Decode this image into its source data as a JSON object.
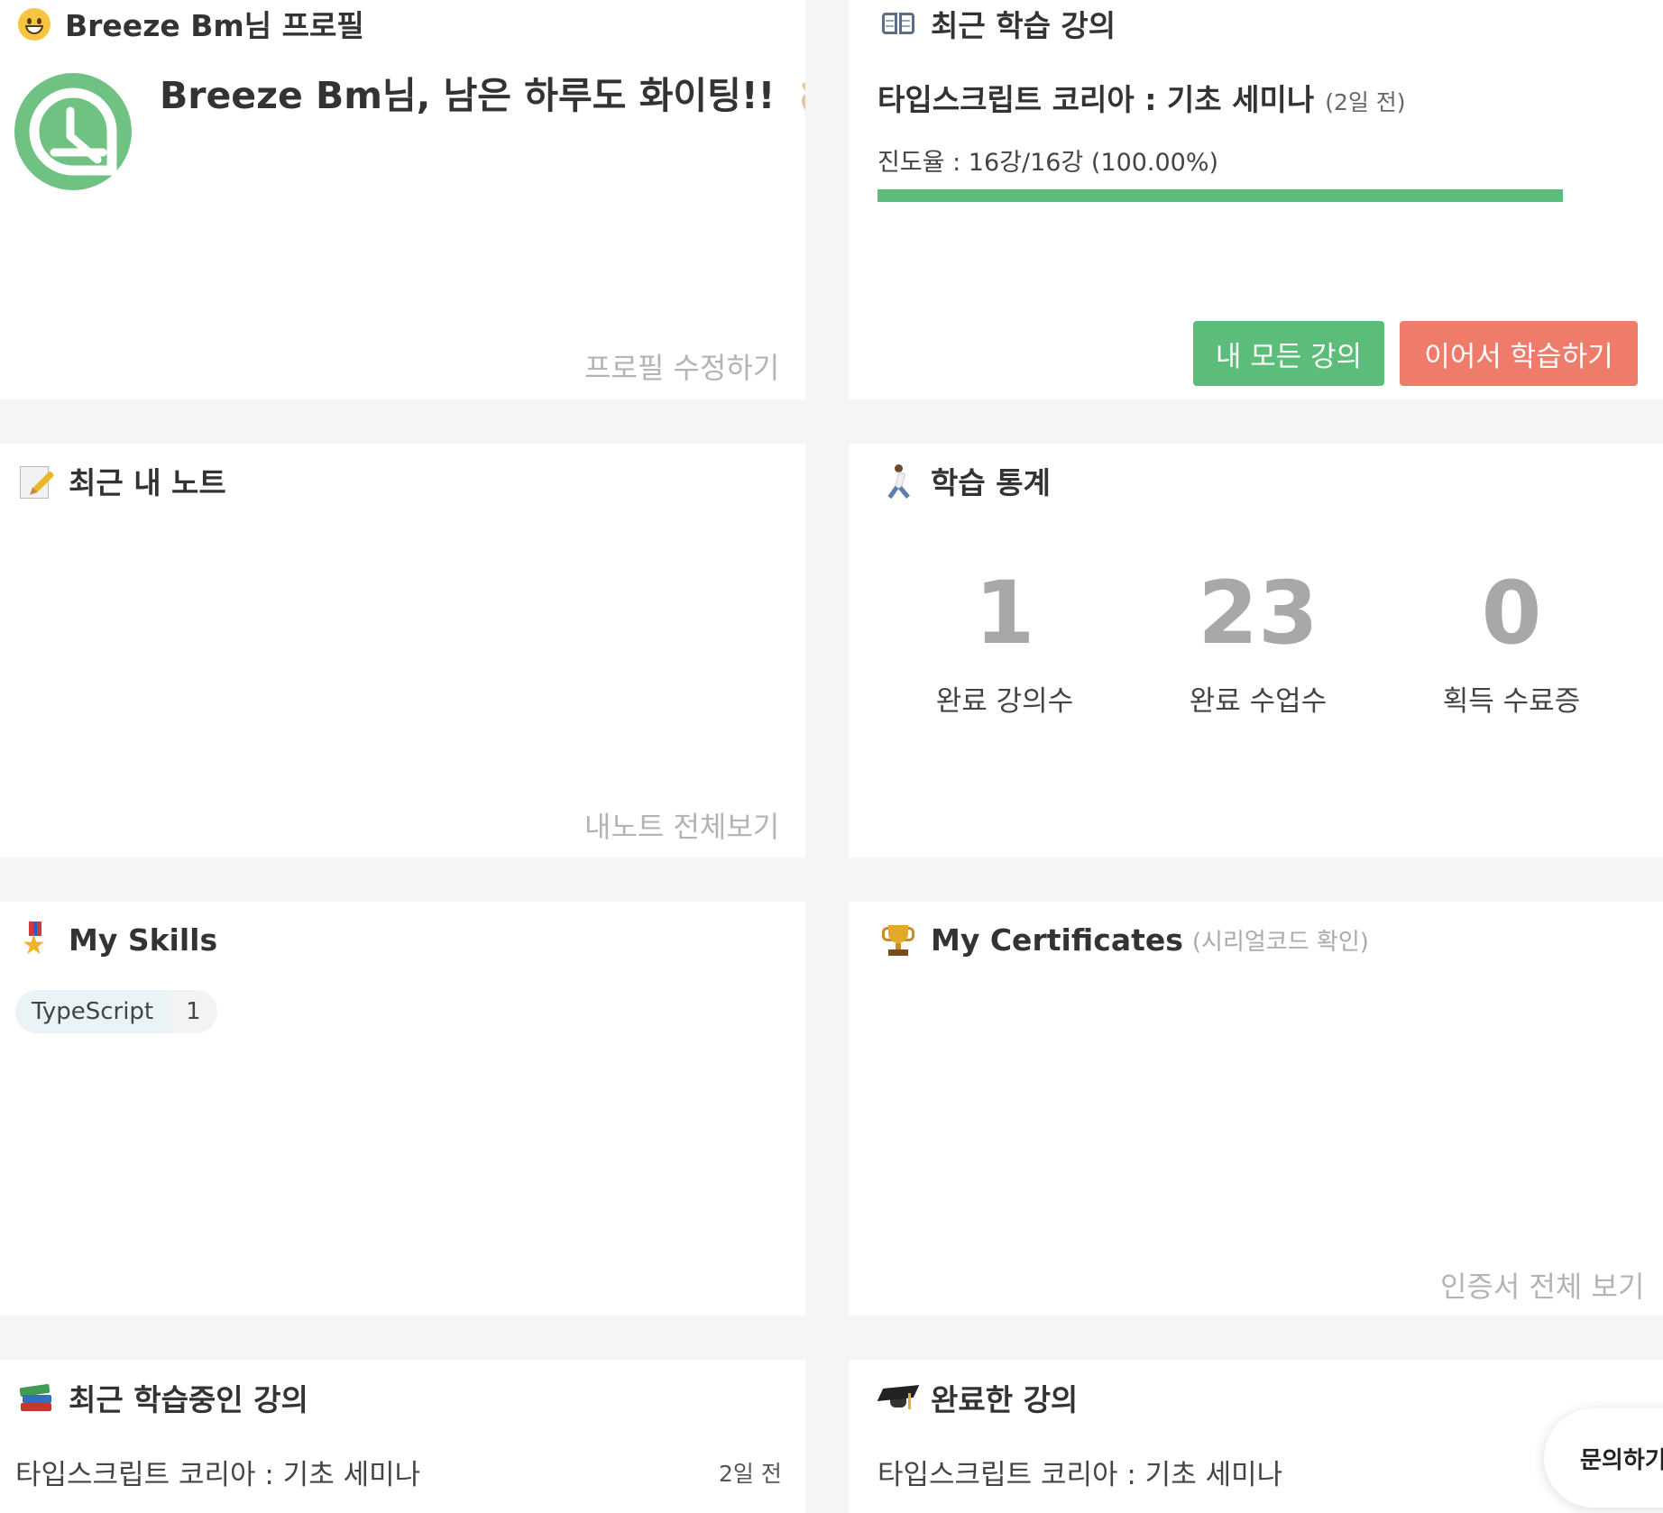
{
  "profile": {
    "title": "Breeze Bm님 프로필",
    "greeting": "Breeze Bm님, 남은 하루도 화이팅!!",
    "edit_link": "프로필 수정하기"
  },
  "recent_course": {
    "title": "최근 학습 강의",
    "course_name": "타입스크립트 코리아 : 기초 세미나",
    "ago": "(2일 전)",
    "progress_text": "진도율 : 16강/16강 (100.00%)",
    "progress_fraction": 1.0,
    "all_courses_button": "내 모든 강의",
    "continue_button": "이어서 학습하기"
  },
  "notes": {
    "title": "최근 내 노트",
    "view_all_link": "내노트 전체보기"
  },
  "stats": {
    "title": "학습 통계",
    "items": [
      {
        "value": "1",
        "label": "완료 강의수"
      },
      {
        "value": "23",
        "label": "완료 수업수"
      },
      {
        "value": "0",
        "label": "획득 수료증"
      }
    ]
  },
  "skills": {
    "title": "My Skills",
    "items": [
      {
        "name": "TypeScript",
        "count": "1"
      }
    ]
  },
  "certificates": {
    "title": "My Certificates",
    "subtitle": "(시리얼코드 확인)",
    "view_all_link": "인증서 전체 보기"
  },
  "learning_courses": {
    "title": "최근 학습중인 강의",
    "items": [
      {
        "name": "타입스크립트 코리아 : 기초 세미나",
        "ago": "2일 전"
      }
    ]
  },
  "completed_courses": {
    "title": "완료한 강의",
    "items": [
      {
        "name": "타입스크립트 코리아 : 기초 세미나"
      }
    ]
  },
  "inquiry_button": "문의하기",
  "colors": {
    "accent_green": "#5cbd7a",
    "accent_red": "#ef7b6b",
    "muted_text": "#b4b4b4"
  },
  "icons": {
    "profile": "smiley-icon",
    "recent_course": "open-book-icon",
    "notes": "memo-icon",
    "stats": "runner-icon",
    "skills": "medal-icon",
    "certificates": "trophy-icon",
    "learning_courses": "books-icon",
    "completed_courses": "graduation-cap-icon"
  }
}
